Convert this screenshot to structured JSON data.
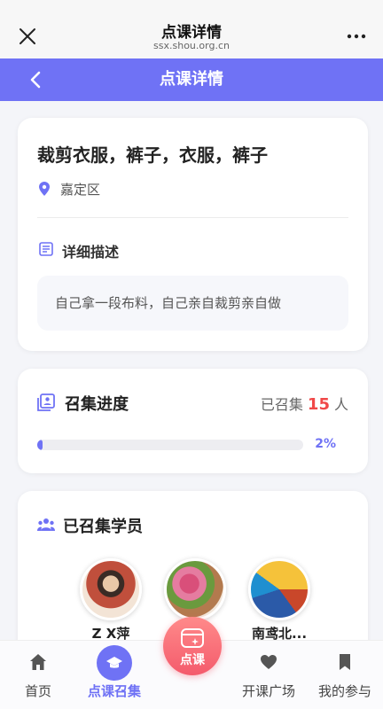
{
  "browser": {
    "title": "点课详情",
    "url": "ssx.shou.org.cn"
  },
  "header": {
    "title": "点课详情"
  },
  "course": {
    "title": "裁剪衣服，裤子，衣服，裤子",
    "location": "嘉定区",
    "description_label": "详细描述",
    "description": "自己拿一段布料，自己亲自裁剪亲自做"
  },
  "progress": {
    "label": "召集进度",
    "count_prefix": "已召集",
    "count": "15",
    "count_unit": "人",
    "percent_text": "2%",
    "percent_value": 2
  },
  "students": {
    "label": "已召集学员",
    "list": [
      {
        "name": "Z X萍"
      },
      {
        "name": ""
      },
      {
        "name": "南鸢北..."
      }
    ]
  },
  "tabbar": {
    "items": [
      {
        "label": "首页",
        "icon": "home-icon"
      },
      {
        "label": "点课召集",
        "icon": "graduation-cap-icon"
      },
      {
        "label": "点课",
        "icon": "sparkle-card-icon"
      },
      {
        "label": "开课广场",
        "icon": "heart-icon"
      },
      {
        "label": "我的参与",
        "icon": "bookmark-icon"
      }
    ]
  },
  "colors": {
    "accent": "#6f72f5",
    "highlight": "#f04848",
    "center_button": "#f45b6c"
  }
}
